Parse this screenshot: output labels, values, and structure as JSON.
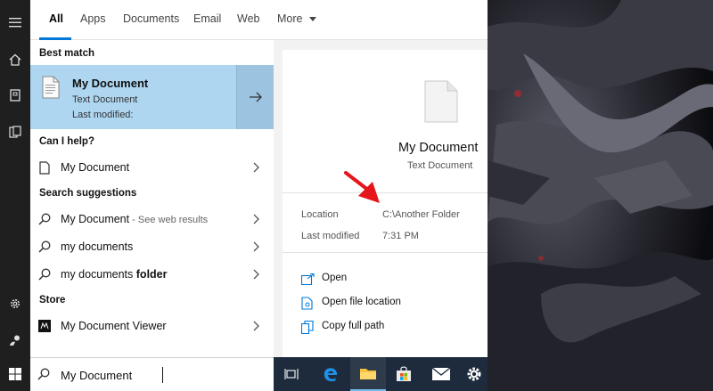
{
  "tabs": [
    {
      "label": "All"
    },
    {
      "label": "Apps"
    },
    {
      "label": "Documents"
    },
    {
      "label": "Email"
    },
    {
      "label": "Web"
    },
    {
      "label": "More"
    }
  ],
  "best_match": {
    "section": "Best match",
    "title": "My Document",
    "type": "Text Document",
    "modified_label": "Last modified:"
  },
  "can_help": {
    "section": "Can I help?",
    "item": "My Document"
  },
  "suggestions": {
    "section": "Search suggestions",
    "items": [
      {
        "bold": "My Document",
        "extra": " - See web results",
        "rest": ""
      },
      {
        "bold": "",
        "extra": "",
        "rest": "my documents"
      },
      {
        "bold": "folder",
        "extra": "",
        "rest": "my documents "
      }
    ]
  },
  "store": {
    "section": "Store",
    "item": "My Document Viewer"
  },
  "details": {
    "name": "My Document",
    "type": "Text Document",
    "location_label": "Location",
    "location_value": "C:\\Another Folder",
    "modified_label": "Last modified",
    "modified_value": "7:31 PM"
  },
  "actions": [
    {
      "label": "Open",
      "icon": "open-icon"
    },
    {
      "label": "Open file location",
      "icon": "folder-location-icon"
    },
    {
      "label": "Copy full path",
      "icon": "copy-path-icon"
    }
  ],
  "search": {
    "value": "My Document"
  },
  "colors": {
    "accent": "#0078d7",
    "highlight": "#aed6f1",
    "annotation_arrow": "#e5151b"
  }
}
